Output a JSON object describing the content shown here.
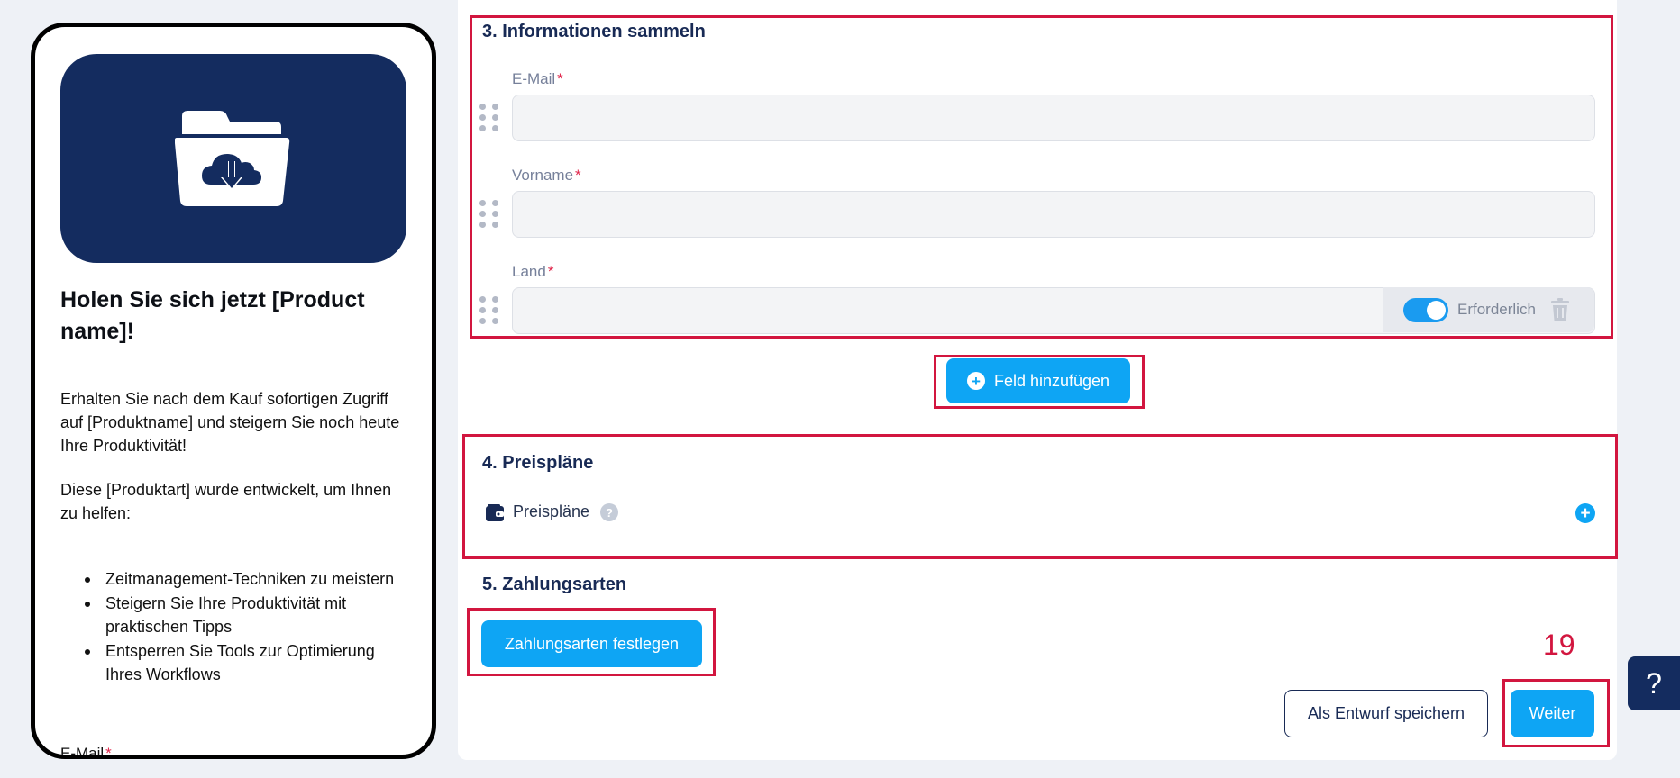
{
  "preview": {
    "title": "Holen Sie sich jetzt [Product name]!",
    "paragraph1": "Erhalten Sie nach dem Kauf sofortigen Zugriff auf [Produktname] und steigern Sie noch heute Ihre Produktivität!",
    "paragraph2": "Diese [Produktart] wurde entwickelt, um Ihnen zu helfen:",
    "bullets": [
      "Zeitmanagement-Techniken zu meistern",
      "Steigern Sie Ihre Produktivität mit praktischen Tipps",
      "Entsperren Sie Tools zur Optimierung Ihres Workflows"
    ],
    "email_label": "E-Mail",
    "required_mark": "*"
  },
  "section3": {
    "title": "3. Informationen sammeln",
    "fields": [
      {
        "label": "E-Mail",
        "required": "*"
      },
      {
        "label": "Vorname",
        "required": "*"
      },
      {
        "label": "Land",
        "required": "*"
      }
    ],
    "required_toggle_label": "Erforderlich",
    "required_toggle_on": true,
    "add_field_button": "Feld hinzufügen"
  },
  "section4": {
    "title": "4. Preispläne",
    "row_label": "Preispläne",
    "help": "?",
    "add": "+"
  },
  "section5": {
    "title": "5. Zahlungsarten",
    "set_payment_button": "Zahlungsarten festlegen"
  },
  "footer": {
    "save_draft_button": "Als Entwurf speichern",
    "next_button": "Weiter",
    "step_number": "19"
  },
  "help_button": "?",
  "colors": {
    "accent": "#0ea5f4",
    "navy": "#142c5f",
    "highlight": "#d2163f"
  }
}
